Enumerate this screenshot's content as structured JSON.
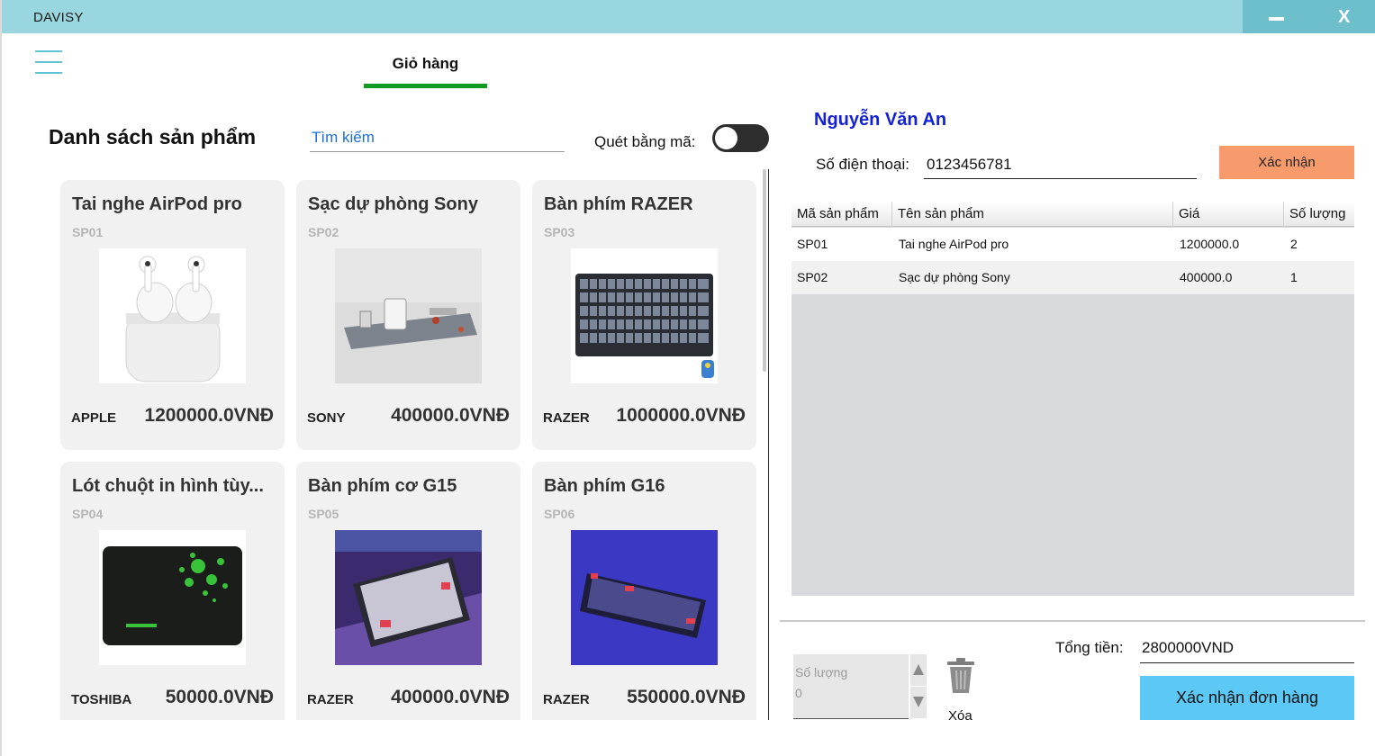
{
  "window": {
    "title": "DAVISY",
    "minimize_label": "minimize",
    "close_symbol": "X"
  },
  "nav": {
    "menu_icon": "hamburger-menu-icon",
    "cart_tab": "Giỏ hàng"
  },
  "products_panel": {
    "title": "Danh sách sản phẩm",
    "search_placeholder": "Tìm kiếm",
    "scan_label": "Quét bằng mã:",
    "scan_enabled": true,
    "products": [
      {
        "name": "Tai nghe AirPod pro",
        "code": "SP01",
        "brand": "APPLE",
        "price": "1200000.0VNĐ",
        "image": "airpods-image"
      },
      {
        "name": "Sạc dự phòng Sony",
        "code": "SP02",
        "brand": "SONY",
        "price": "400000.0VNĐ",
        "image": "power-bank-image"
      },
      {
        "name": "Bàn phím RAZER",
        "code": "SP03",
        "brand": "RAZER",
        "price": "1000000.0VNĐ",
        "image": "keyboard-image"
      },
      {
        "name": "Lót chuột in hình tùy...",
        "code": "SP04",
        "brand": "TOSHIBA",
        "price": "50000.0VNĐ",
        "image": "mousepad-image"
      },
      {
        "name": "Bàn phím cơ G15",
        "code": "SP05",
        "brand": "RAZER",
        "price": "400000.0VNĐ",
        "image": "mechanical-keyboard-image"
      },
      {
        "name": "Bàn phím G16",
        "code": "SP06",
        "brand": "RAZER",
        "price": "550000.0VNĐ",
        "image": "keyboard-blue-image"
      }
    ]
  },
  "cart_panel": {
    "customer_name": "Nguyễn Văn An",
    "phone_label": "Số điện thoại:",
    "phone_value": "0123456781",
    "confirm_label": "Xác nhận",
    "table": {
      "headers": [
        "Mã sản phẩm",
        "Tên sản phẩm",
        "Giá",
        "Số lượng"
      ],
      "rows": [
        [
          "SP01",
          "Tai nghe AirPod pro",
          "1200000.0",
          "2"
        ],
        [
          "SP02",
          "Sạc dự phòng Sony",
          "400000.0",
          "1"
        ]
      ]
    },
    "quantity_placeholder": "Số lượng",
    "quantity_value": "0",
    "delete_label": "Xóa",
    "total_label": "Tổng tiền:",
    "total_value": "2800000VND",
    "order_button": "Xác nhận đơn hàng"
  },
  "colors": {
    "titlebar": "#9ad6e0",
    "tab_underline": "#109a24",
    "customer": "#1322d8",
    "confirm": "#f79a6c",
    "order": "#5cc8f5"
  }
}
